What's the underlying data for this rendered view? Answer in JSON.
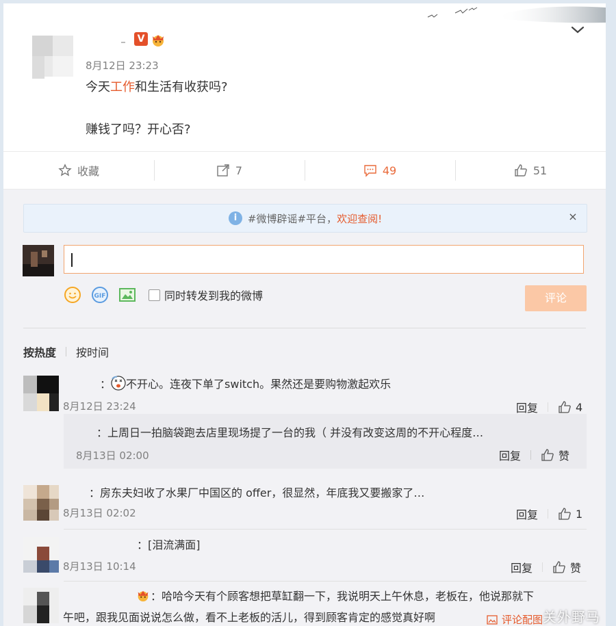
{
  "post": {
    "time": "8月12日 23:23",
    "badge_v": "V",
    "text_line1_a": "今天",
    "text_line1_kw": "工作",
    "text_line1_b": "和生活有收获吗?",
    "text_line2": "赚钱了吗？开心否?"
  },
  "actions": {
    "favorite": "收藏",
    "repost_count": "7",
    "comment_count": "49",
    "like_count": "51"
  },
  "notice": {
    "text": "#微博辟谣#平台，",
    "highlight": "欢迎查阅!",
    "close": "×"
  },
  "composer": {
    "sync_label": "同时转发到我的微博",
    "submit_label": "评论"
  },
  "sort": {
    "hot": "按热度",
    "time": "按时间"
  },
  "comments": [
    {
      "prefix": "：",
      "text": "不开心。连夜下单了switch。果然还是要购物激起欢乐",
      "time": "8月12日 23:24",
      "reply_label": "回复",
      "likes": "4"
    },
    {
      "prefix": "：",
      "text": "上周日一拍脑袋跑去店里现场提了一台的我（ 并没有改变这周的不开心程度…",
      "time": "8月13日 02:00",
      "reply_label": "回复",
      "likes": "赞"
    },
    {
      "prefix": "：",
      "text": "房东夫妇收了水果厂中国区的 offer，很显然，年底我又要搬家了…",
      "time": "8月13日 02:02",
      "reply_label": "回复",
      "likes": "1"
    },
    {
      "prefix": "：",
      "text": "[泪流满面]",
      "time": "8月13日 10:14",
      "reply_label": "回复",
      "likes": "赞"
    },
    {
      "prefix": "：",
      "text_line1": "哈哈今天有个顾客想把草缸翻一下，我说明天上午休息，老板在，他说那就下",
      "text_line2": "午吧，跟我见面说说怎么做，看不上老板的活儿，得到顾客肯定的感觉真好啊",
      "pic_link": "评论配图"
    }
  ],
  "watermark": "关外野马"
}
